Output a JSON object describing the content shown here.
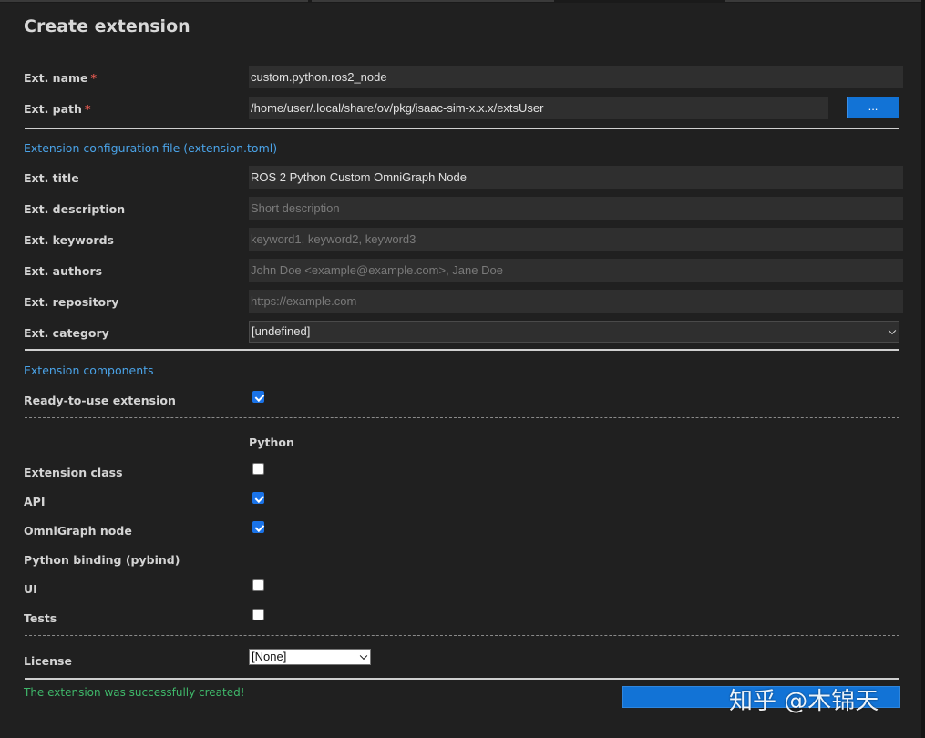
{
  "title": "Create extension",
  "required_mark": "*",
  "fields": {
    "name": {
      "label": "Ext. name",
      "value": "custom.python.ros2_node"
    },
    "path": {
      "label": "Ext. path",
      "value": "/home/user/.local/share/ov/pkg/isaac-sim-x.x.x/extsUser",
      "browse_label": "..."
    }
  },
  "config_section": {
    "header": "Extension configuration file (extension.toml)",
    "title": {
      "label": "Ext. title",
      "value": "ROS 2 Python Custom OmniGraph Node"
    },
    "description": {
      "label": "Ext. description",
      "placeholder": "Short description"
    },
    "keywords": {
      "label": "Ext. keywords",
      "placeholder": "keyword1, keyword2, keyword3"
    },
    "authors": {
      "label": "Ext. authors",
      "placeholder": "John Doe <example@example.com>, Jane Doe"
    },
    "repository": {
      "label": "Ext. repository",
      "placeholder": "https://example.com"
    },
    "category": {
      "label": "Ext. category",
      "value": "[undefined]"
    }
  },
  "components_section": {
    "header": "Extension components",
    "ready_to_use": {
      "label": "Ready-to-use extension",
      "checked": true
    },
    "column_header": "Python",
    "rows": [
      {
        "label": "Extension class",
        "checkbox": true,
        "checked": false
      },
      {
        "label": "API",
        "checkbox": true,
        "checked": true
      },
      {
        "label": "OmniGraph node",
        "checkbox": true,
        "checked": true
      },
      {
        "label": "Python binding (pybind)",
        "checkbox": false,
        "checked": false
      },
      {
        "label": "UI",
        "checkbox": true,
        "checked": false
      },
      {
        "label": "Tests",
        "checkbox": true,
        "checked": false
      }
    ]
  },
  "license": {
    "label": "License",
    "value": "[None]"
  },
  "status_message": "The extension was successfully created!",
  "create_button": {
    "label": ""
  },
  "watermark": "知乎 @木锦天",
  "colors": {
    "background": "#202020",
    "field_bg": "#2f2f2f",
    "accent_blue": "#1273d6",
    "section_link": "#4aa3e8",
    "success": "#3fb86a",
    "required": "#e0584f"
  }
}
